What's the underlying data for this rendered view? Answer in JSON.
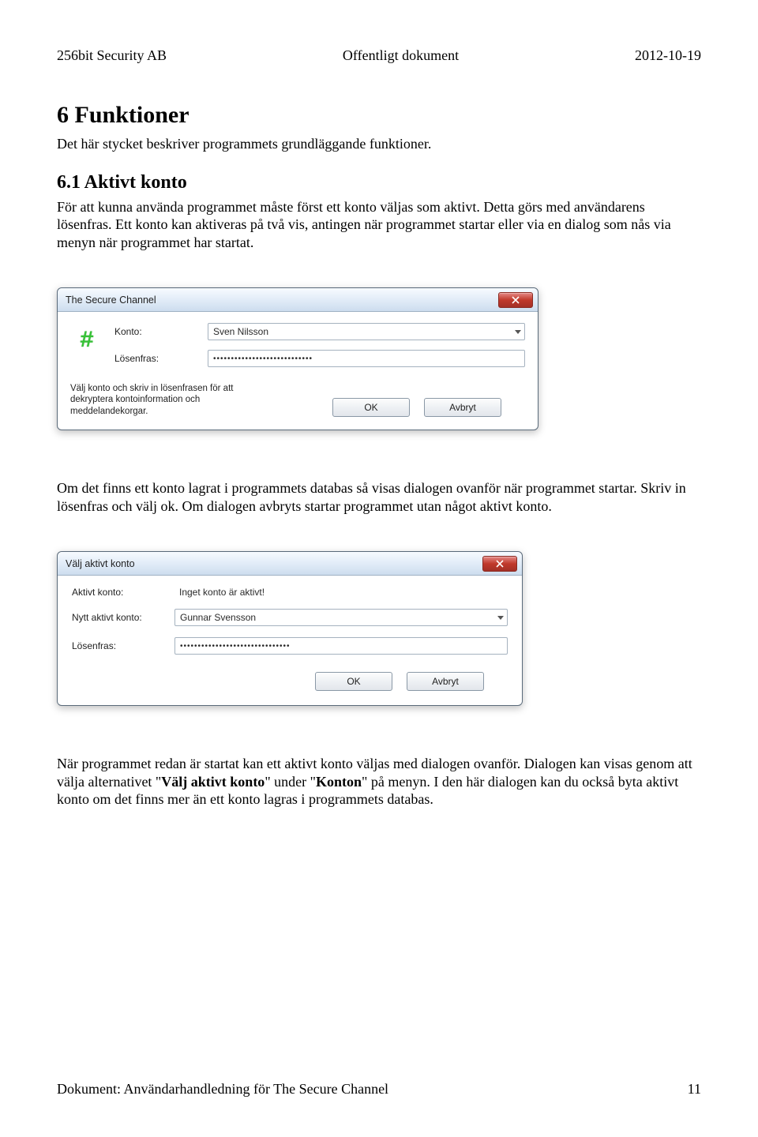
{
  "header": {
    "left": "256bit Security AB",
    "center": "Offentligt dokument",
    "right": "2012-10-19"
  },
  "section": {
    "h1": "6 Funktioner",
    "intro": "Det här stycket beskriver programmets grundläggande funktioner.",
    "h2": "6.1 Aktivt konto",
    "p1": "För att kunna använda programmet måste först ett konto väljas som aktivt. Detta görs med användarens lösenfras. Ett konto kan aktiveras på två vis, antingen när programmet startar eller via en dialog som nås via menyn när programmet har startat.",
    "p2": "Om det finns ett konto lagrat i programmets databas så visas dialogen ovanför när programmet startar. Skriv in lösenfras och välj ok. Om dialogen avbryts startar programmet utan något aktivt konto.",
    "p3a": "När programmet redan är startat kan ett aktivt konto väljas med dialogen ovanför. Dialogen kan visas genom att välja alternativet \"",
    "p3b": "\" under \"",
    "p3c": "\" på menyn. I den här dialogen kan du också byta aktivt konto om det finns mer än ett konto lagras i programmets databas.",
    "bold1": "Välj aktivt konto",
    "bold2": "Konton"
  },
  "dialog1": {
    "title": "The Secure Channel",
    "icon": "#",
    "labels": {
      "konto": "Konto:",
      "losenfras": "Lösenfras:"
    },
    "konto_value": "Sven Nilsson",
    "losenfras_value": "••••••••••••••••••••••••••••",
    "hint": "Välj konto och skriv in lösenfrasen för att dekryptera kontoinformation och meddelandekorgar.",
    "ok": "OK",
    "cancel": "Avbryt"
  },
  "dialog2": {
    "title": "Välj aktivt konto",
    "labels": {
      "aktivt": "Aktivt konto:",
      "nytt": "Nytt aktivt konto:",
      "losenfras": "Lösenfras:"
    },
    "aktivt_value": "Inget konto är aktivt!",
    "nytt_value": "Gunnar Svensson",
    "losenfras_value": "•••••••••••••••••••••••••••••••",
    "ok": "OK",
    "cancel": "Avbryt"
  },
  "footer": {
    "left": "Dokument: Användarhandledning för The Secure Channel",
    "right": "11"
  }
}
